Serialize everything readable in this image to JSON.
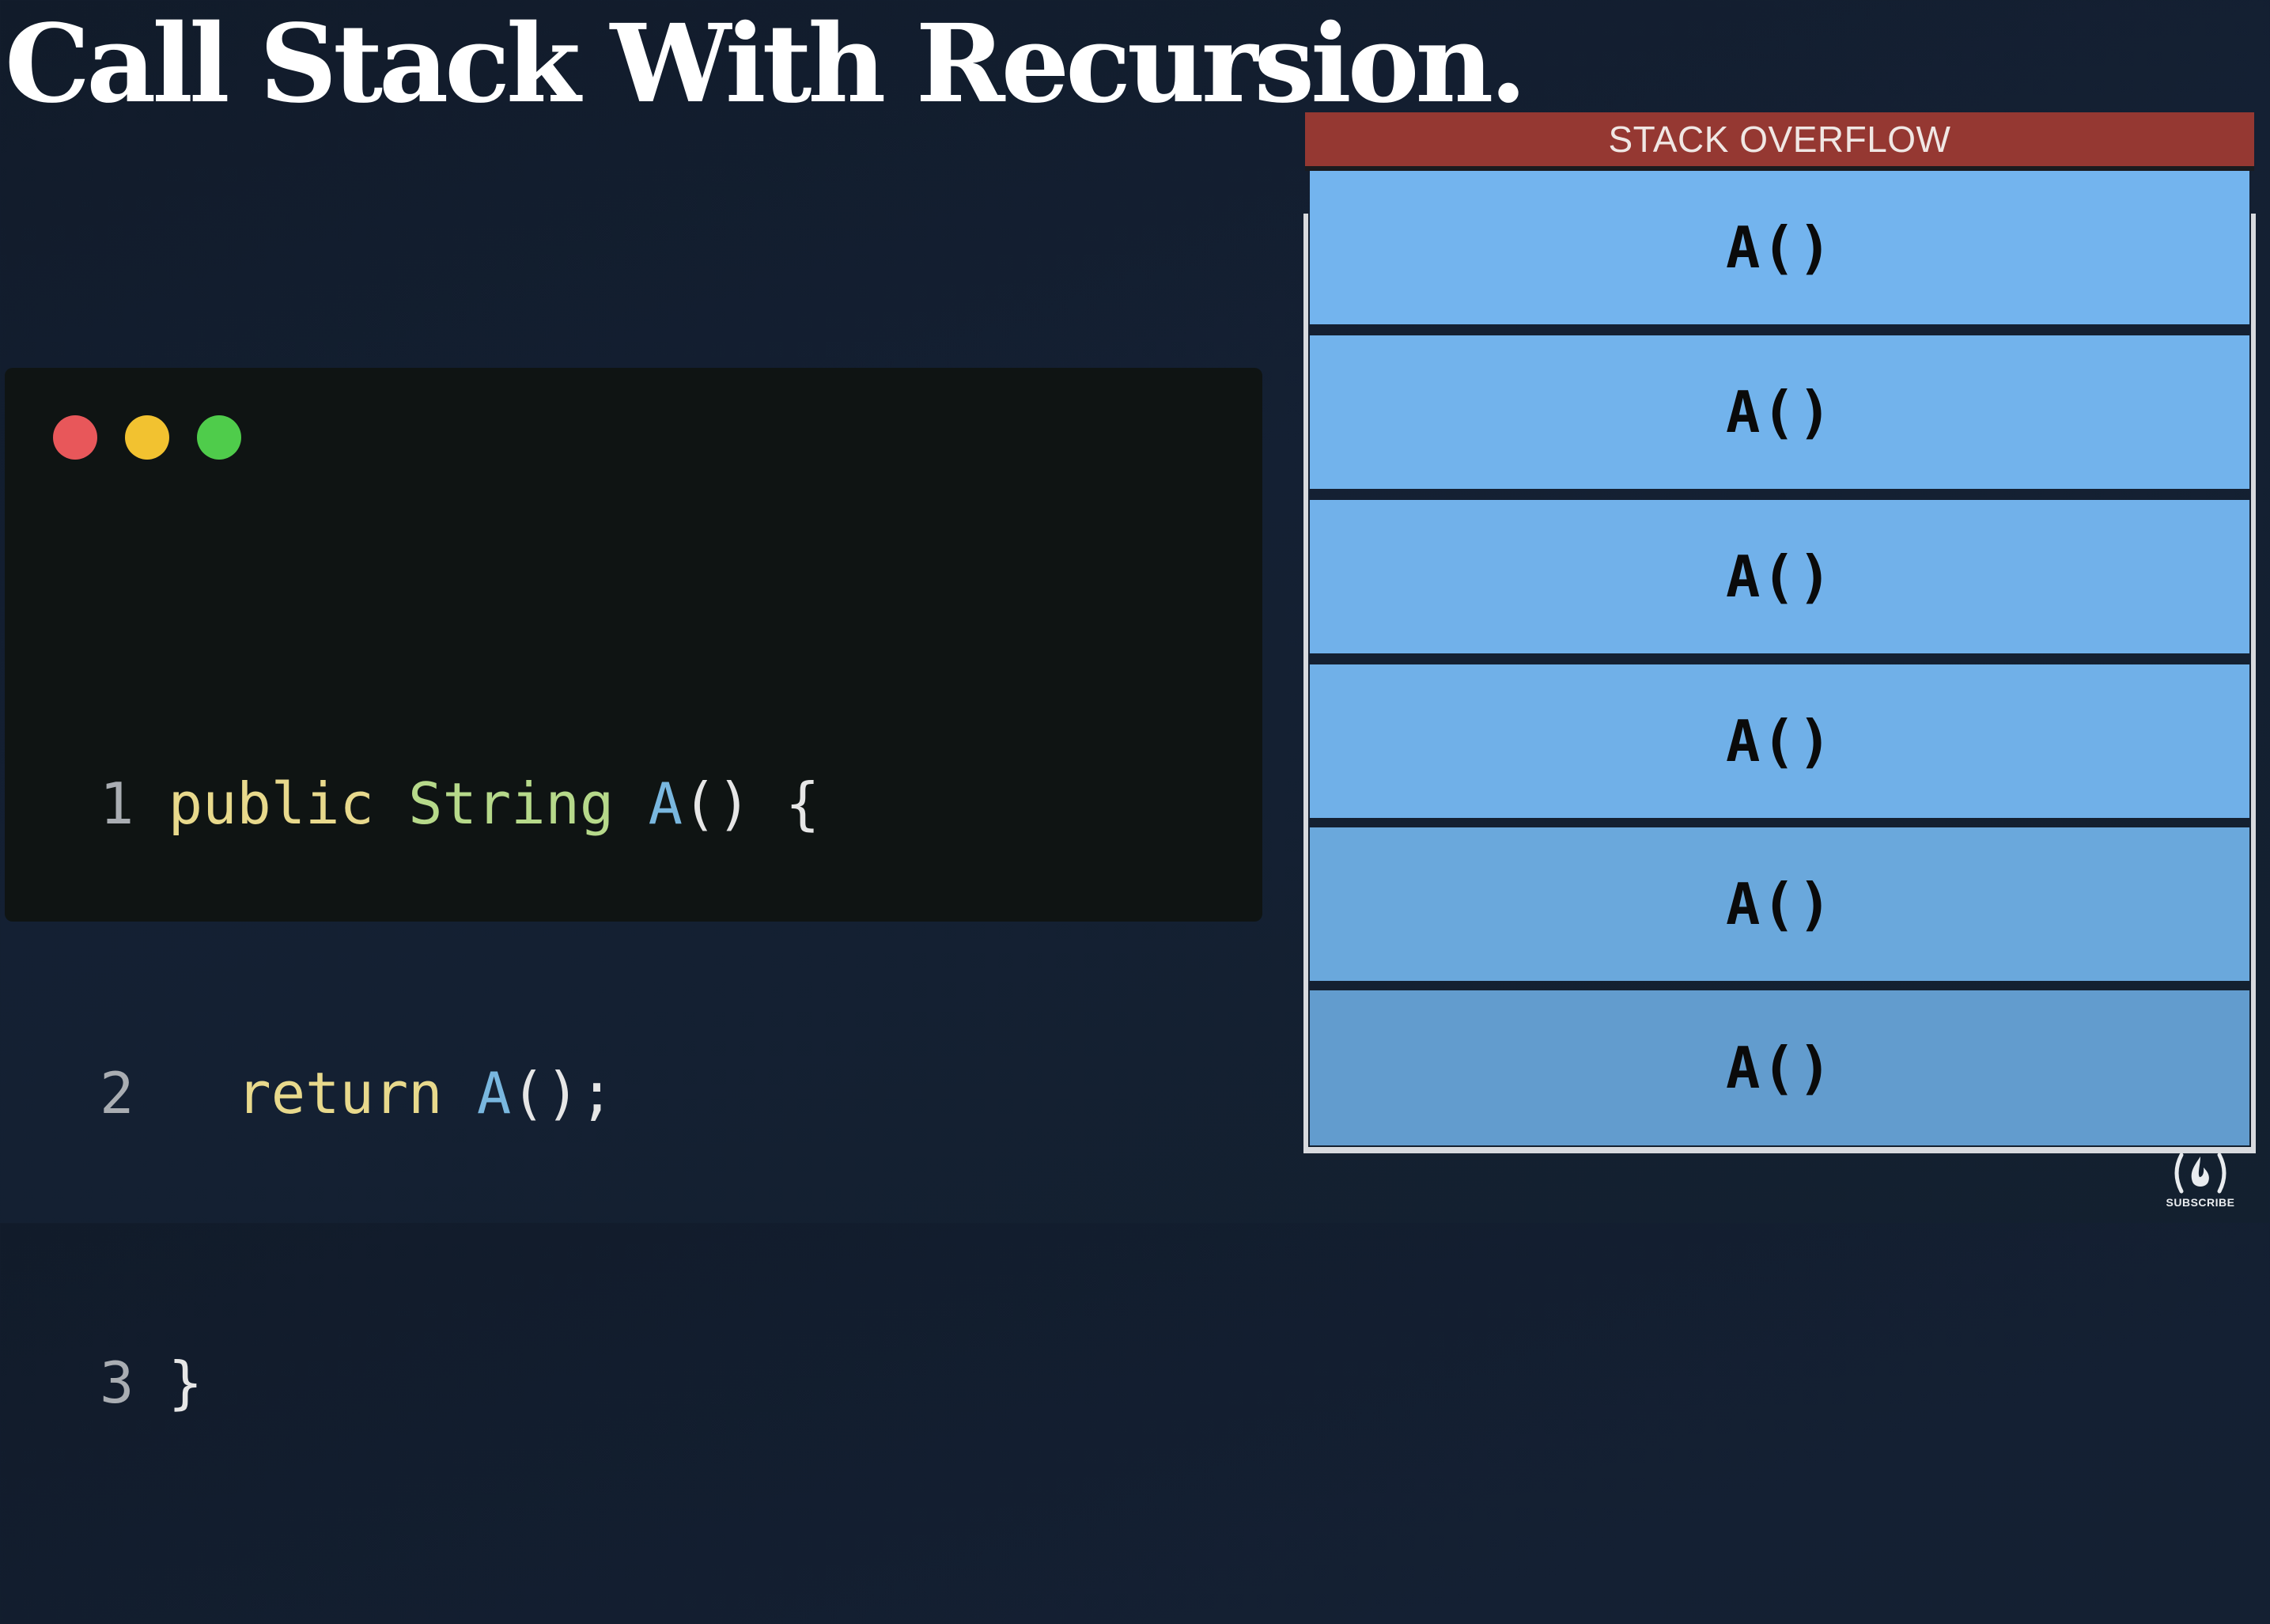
{
  "title": "Call Stack With Recursion.",
  "code_window": {
    "dots": [
      {
        "name": "close",
        "color": "#e8575a"
      },
      {
        "name": "minimize",
        "color": "#f2c230"
      },
      {
        "name": "maximize",
        "color": "#4fcc4b"
      }
    ],
    "lines": [
      {
        "number": "1",
        "indent": "",
        "keyword": "public",
        "type": " String",
        "fn": " A",
        "punct": "() {"
      },
      {
        "number": "2",
        "indent": "  ",
        "keyword": "return",
        "type": "",
        "fn": " A",
        "punct": "();"
      },
      {
        "number": "3",
        "indent": "",
        "keyword": "",
        "type": "",
        "fn": "",
        "punct": "}"
      }
    ]
  },
  "stack": {
    "overflow_label": "STACK OVERFLOW",
    "overflow_color": "#953832",
    "frames": [
      {
        "label": "A()",
        "color": "#73b4ee"
      },
      {
        "label": "A()",
        "color": "#72b3ec"
      },
      {
        "label": "A()",
        "color": "#71b1ea"
      },
      {
        "label": "A()",
        "color": "#70b0e8"
      },
      {
        "label": "A()",
        "color": "#6aa8dc"
      },
      {
        "label": "A()",
        "color": "#629cce"
      }
    ]
  },
  "subscribe_label": "SUBSCRIBE"
}
